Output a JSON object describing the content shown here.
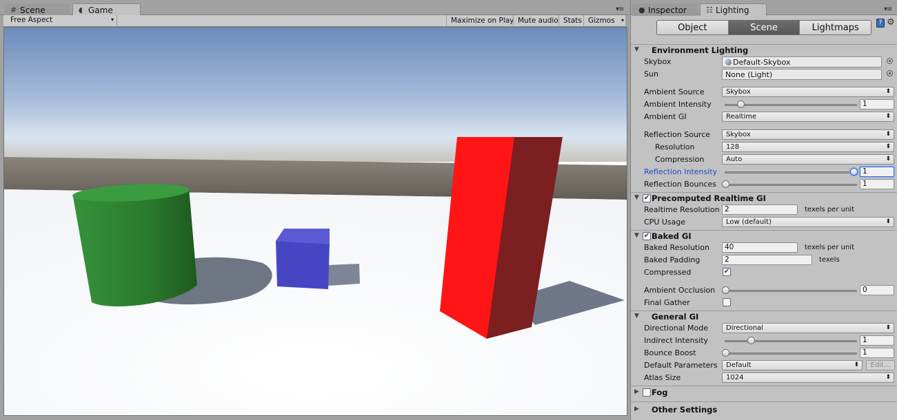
{
  "game_window": {
    "tabs": [
      {
        "label": "Scene",
        "icon": "grid-icon"
      },
      {
        "label": "Game",
        "icon": "pacman-icon"
      }
    ],
    "toolbar": {
      "aspect": "Free Aspect",
      "maximize": "Maximize on Play",
      "mute": "Mute audio",
      "stats": "Stats",
      "gizmos": "Gizmos"
    }
  },
  "inspector_window": {
    "tabs": [
      {
        "label": "Inspector",
        "icon": "info-icon"
      },
      {
        "label": "Lighting",
        "icon": "lighting-icon"
      }
    ],
    "modes": [
      "Object",
      "Scene",
      "Lightmaps"
    ],
    "active_mode": "Scene",
    "environment": {
      "title": "Environment Lighting",
      "skybox_label": "Skybox",
      "skybox_value": "Default-Skybox",
      "sun_label": "Sun",
      "sun_value": "None (Light)",
      "ambient_source_label": "Ambient Source",
      "ambient_source_value": "Skybox",
      "ambient_intensity_label": "Ambient Intensity",
      "ambient_intensity_value": "1",
      "ambient_intensity_slider": 0.12,
      "ambient_gi_label": "Ambient GI",
      "ambient_gi_value": "Realtime",
      "reflection_source_label": "Reflection Source",
      "reflection_source_value": "Skybox",
      "resolution_label": "Resolution",
      "resolution_value": "128",
      "compression_label": "Compression",
      "compression_value": "Auto",
      "reflection_intensity_label": "Reflection Intensity",
      "reflection_intensity_value": "1",
      "reflection_intensity_slider": 1.0,
      "reflection_bounces_label": "Reflection Bounces",
      "reflection_bounces_value": "1",
      "reflection_bounces_slider": 0.0
    },
    "precomputed": {
      "title": "Precomputed Realtime GI",
      "enabled": true,
      "realtime_resolution_label": "Realtime Resolution",
      "realtime_resolution_value": "2",
      "realtime_resolution_unit": "texels per unit",
      "cpu_usage_label": "CPU Usage",
      "cpu_usage_value": "Low (default)"
    },
    "baked": {
      "title": "Baked GI",
      "enabled": true,
      "baked_resolution_label": "Baked Resolution",
      "baked_resolution_value": "40",
      "baked_resolution_unit": "texels per unit",
      "baked_padding_label": "Baked Padding",
      "baked_padding_value": "2",
      "baked_padding_unit": "texels",
      "compressed_label": "Compressed",
      "compressed": true,
      "ambient_occlusion_label": "Ambient Occlusion",
      "ambient_occlusion_value": "0",
      "ambient_occlusion_slider": 0.0,
      "final_gather_label": "Final Gather",
      "final_gather": false
    },
    "general": {
      "title": "General GI",
      "directional_mode_label": "Directional Mode",
      "directional_mode_value": "Directional",
      "indirect_intensity_label": "Indirect Intensity",
      "indirect_intensity_value": "1",
      "indirect_intensity_slider": 0.2,
      "bounce_boost_label": "Bounce Boost",
      "bounce_boost_value": "1",
      "bounce_boost_slider": 0.0,
      "default_parameters_label": "Default Parameters",
      "default_parameters_value": "Default",
      "edit_label": "Edit...",
      "atlas_size_label": "Atlas Size",
      "atlas_size_value": "1024"
    },
    "fog": {
      "title": "Fog",
      "enabled": false
    },
    "other": {
      "title": "Other Settings"
    }
  },
  "colors": {
    "cylinder": "#2f8a32",
    "cube": "#4a4acb",
    "box_front": "#ff1a1a",
    "box_side": "#7a2020",
    "sky_top": "#6f8fbd",
    "horizon": "#6d6860"
  }
}
